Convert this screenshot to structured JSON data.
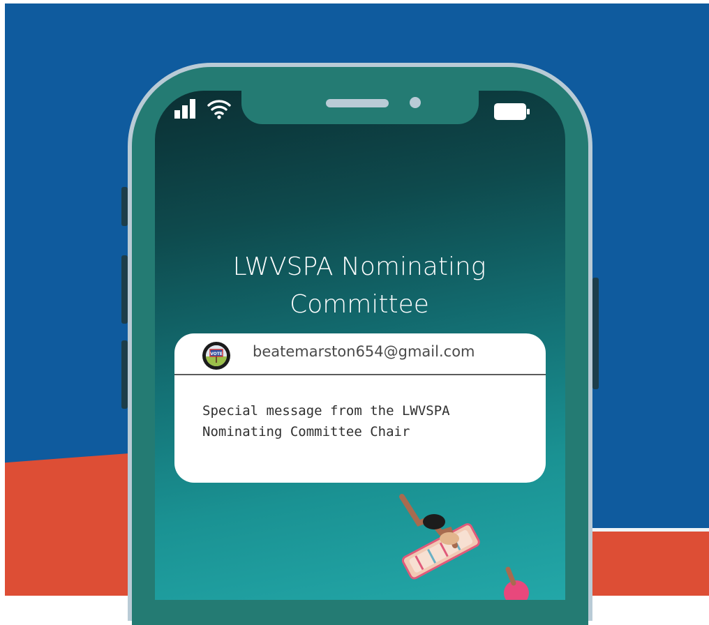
{
  "status_bar": {
    "signal_icon": "cellular-signal-icon",
    "wifi_icon": "wifi-icon",
    "battery_icon": "battery-icon"
  },
  "screen": {
    "title": "LWVSPA Nominating Committee"
  },
  "notification": {
    "avatar_icon": "vote-sign-avatar",
    "sender": "beatemarston654@gmail.com",
    "message": "Special message from the LWVSPA Nominating Committee Chair"
  },
  "colors": {
    "background_blue": "#0f5b9e",
    "background_red": "#dd4e35",
    "phone_frame": "#247b73",
    "phone_bezel": "#b9cbd6"
  }
}
